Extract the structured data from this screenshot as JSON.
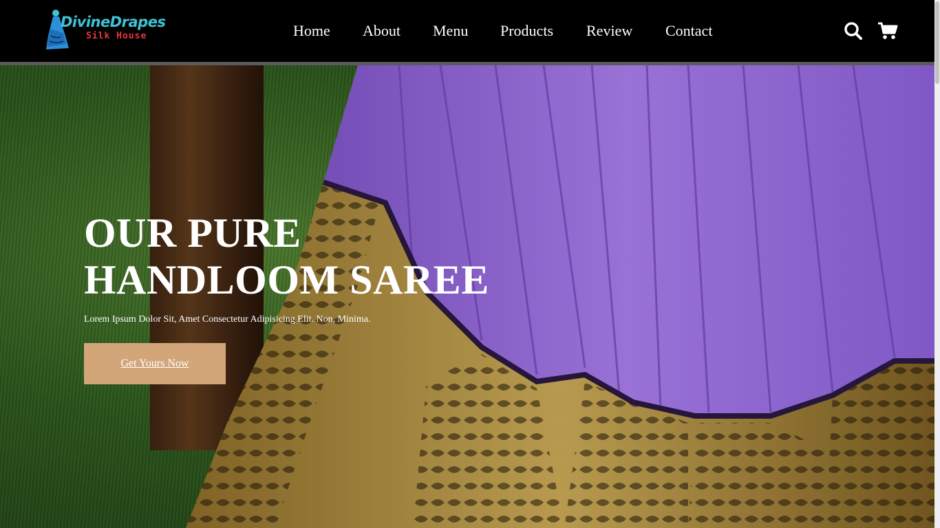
{
  "brand": {
    "name": "DivineDrapes",
    "tagline": "Silk House"
  },
  "nav": {
    "items": [
      {
        "label": "Home"
      },
      {
        "label": "About"
      },
      {
        "label": "Menu"
      },
      {
        "label": "Products"
      },
      {
        "label": "Review"
      },
      {
        "label": "Contact"
      }
    ]
  },
  "icons": {
    "search": "search-icon",
    "cart": "shopping-cart-icon"
  },
  "hero": {
    "title_line1": "OUR PURE",
    "title_line2": "HANDLOOM SAREE",
    "subtitle": "Lorem Ipsum Dolor Sit, Amet Consectetur Adipisicing Elit. Non, Minima.",
    "cta_label": "Get Yours Now"
  },
  "colors": {
    "header_bg": "#000000",
    "accent_button": "#d2a679",
    "logo_primary": "#3fc3d6",
    "logo_secondary": "#e8363e",
    "saree_purple": "#9b6fe0",
    "saree_gold": "#b99a45"
  }
}
